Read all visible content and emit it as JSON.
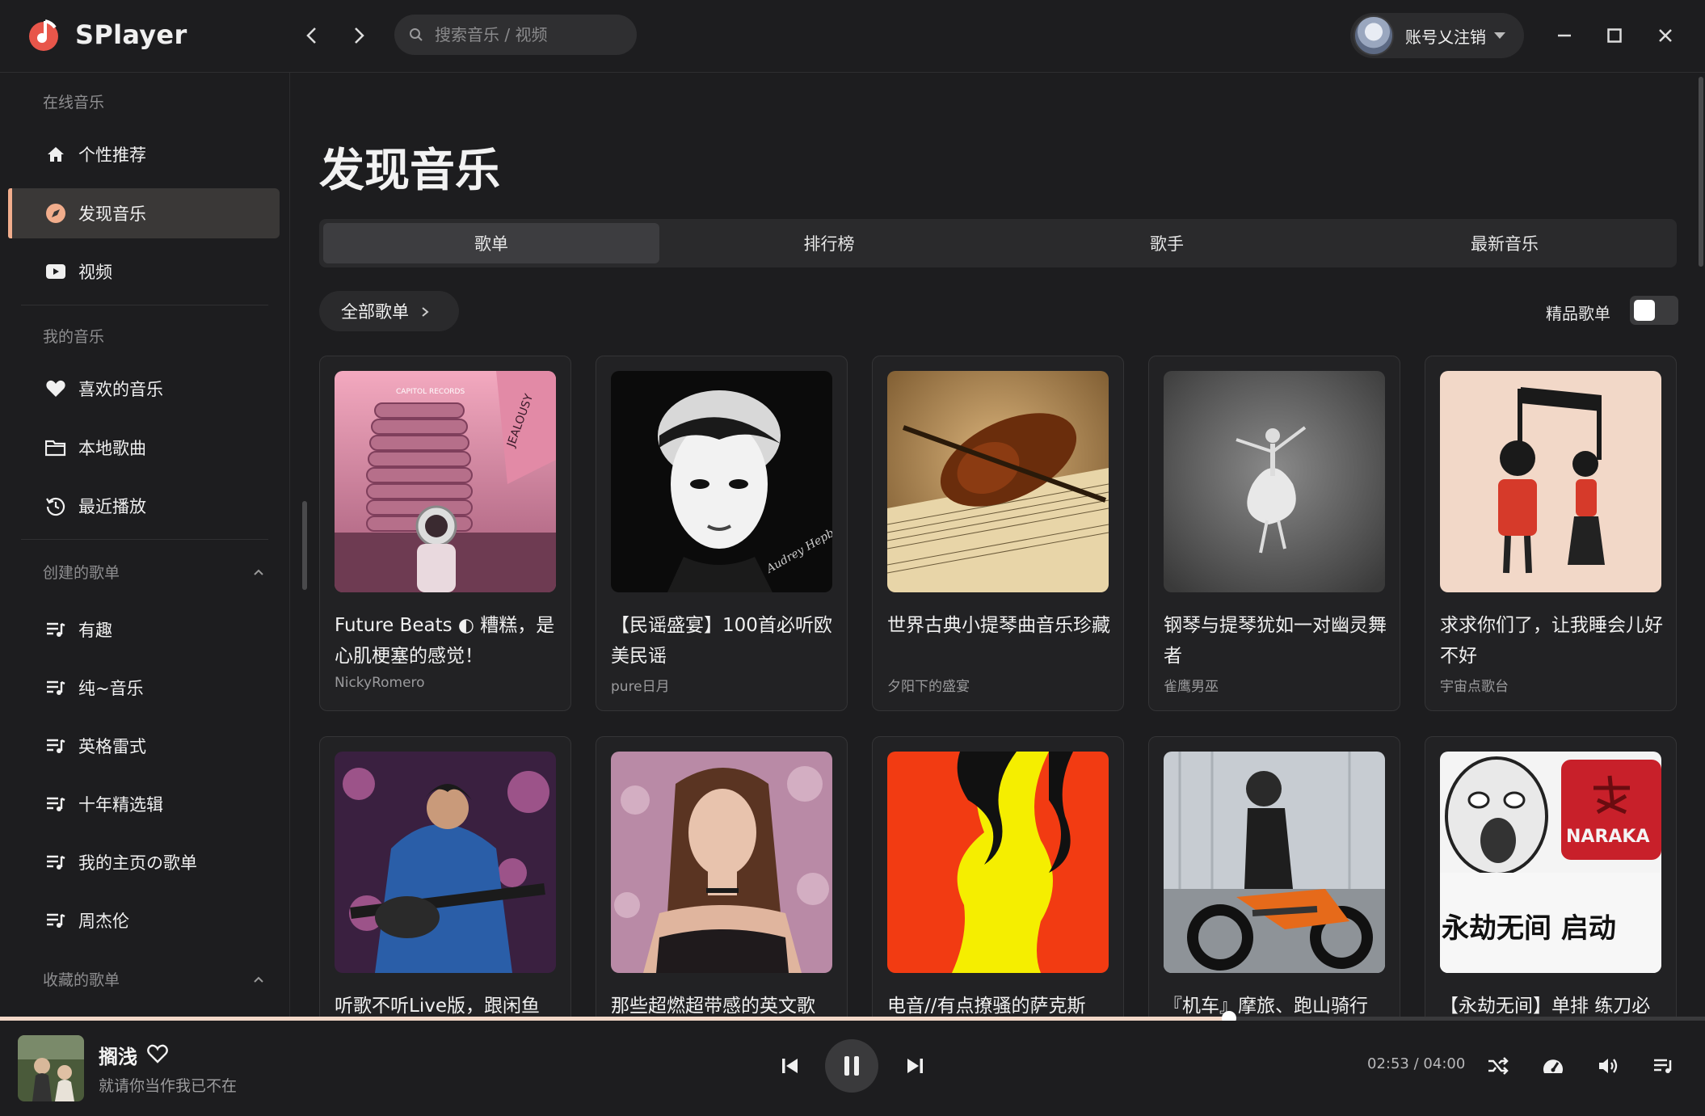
{
  "app": {
    "name": "SPlayer",
    "accent": "#f1ad8c"
  },
  "search": {
    "placeholder": "搜索音乐 / 视频"
  },
  "user": {
    "name": "账号乂注销"
  },
  "sidebar": {
    "online_section": "在线音乐",
    "online_items": [
      {
        "label": "个性推荐",
        "icon": "home-icon"
      },
      {
        "label": "发现音乐",
        "icon": "compass-icon",
        "active": true
      },
      {
        "label": "视频",
        "icon": "video-icon"
      }
    ],
    "my_section": "我的音乐",
    "my_items": [
      {
        "label": "喜欢的音乐",
        "icon": "heart-icon"
      },
      {
        "label": "本地歌曲",
        "icon": "folder-icon"
      },
      {
        "label": "最近播放",
        "icon": "history-icon"
      }
    ],
    "created_section": "创建的歌单",
    "created_items": [
      {
        "label": "有趣"
      },
      {
        "label": "纯~音乐"
      },
      {
        "label": "英格雷式"
      },
      {
        "label": "十年精选辑"
      },
      {
        "label": "我的主页の歌单"
      },
      {
        "label": "周杰伦"
      }
    ],
    "collected_section": "收藏的歌单"
  },
  "main": {
    "title": "发现音乐",
    "tabs": [
      {
        "label": "歌单",
        "active": true
      },
      {
        "label": "排行榜"
      },
      {
        "label": "歌手"
      },
      {
        "label": "最新音乐"
      }
    ],
    "all_playlists_label": "全部歌单",
    "hq_label": "精品歌单",
    "hq_on": false,
    "playlists": [
      {
        "title": "Future Beats ◐ 糟糕，是心肌梗塞的感觉！",
        "author": "NickyRomero"
      },
      {
        "title": "【民谣盛宴】100首必听欧美民谣",
        "author": "pure日月"
      },
      {
        "title": "世界古典小提琴曲音乐珍藏",
        "author": "夕阳下的盛宴"
      },
      {
        "title": "钢琴与提琴犹如一对幽灵舞者",
        "author": "雀鹰男巫"
      },
      {
        "title": "求求你们了，让我睡会儿好不好",
        "author": "宇宙点歌台"
      },
      {
        "title": "听歌不听Live版，跟闲鱼",
        "author": ""
      },
      {
        "title": "那些超燃超带感的英文歌",
        "author": ""
      },
      {
        "title": "电音//有点撩骚的萨克斯",
        "author": ""
      },
      {
        "title": "『机车』摩旅、跑山骑行",
        "author": ""
      },
      {
        "title": "【永劫无间】单排 练刀必",
        "author": ""
      }
    ],
    "cover_texts": {
      "tower_sign": "CAPITOL RECORDS",
      "tower_side": "JEALOUSY",
      "signature": "Audrey Hepburn",
      "naraka_brand": "NARAKA",
      "naraka_slogan": "永劫无间  启动"
    }
  },
  "player": {
    "song": "搁浅",
    "artist": "就请你当作我已不在",
    "current_time": "02:53",
    "separator": "/",
    "total_time": "04:00",
    "progress_fraction": 0.7208
  }
}
